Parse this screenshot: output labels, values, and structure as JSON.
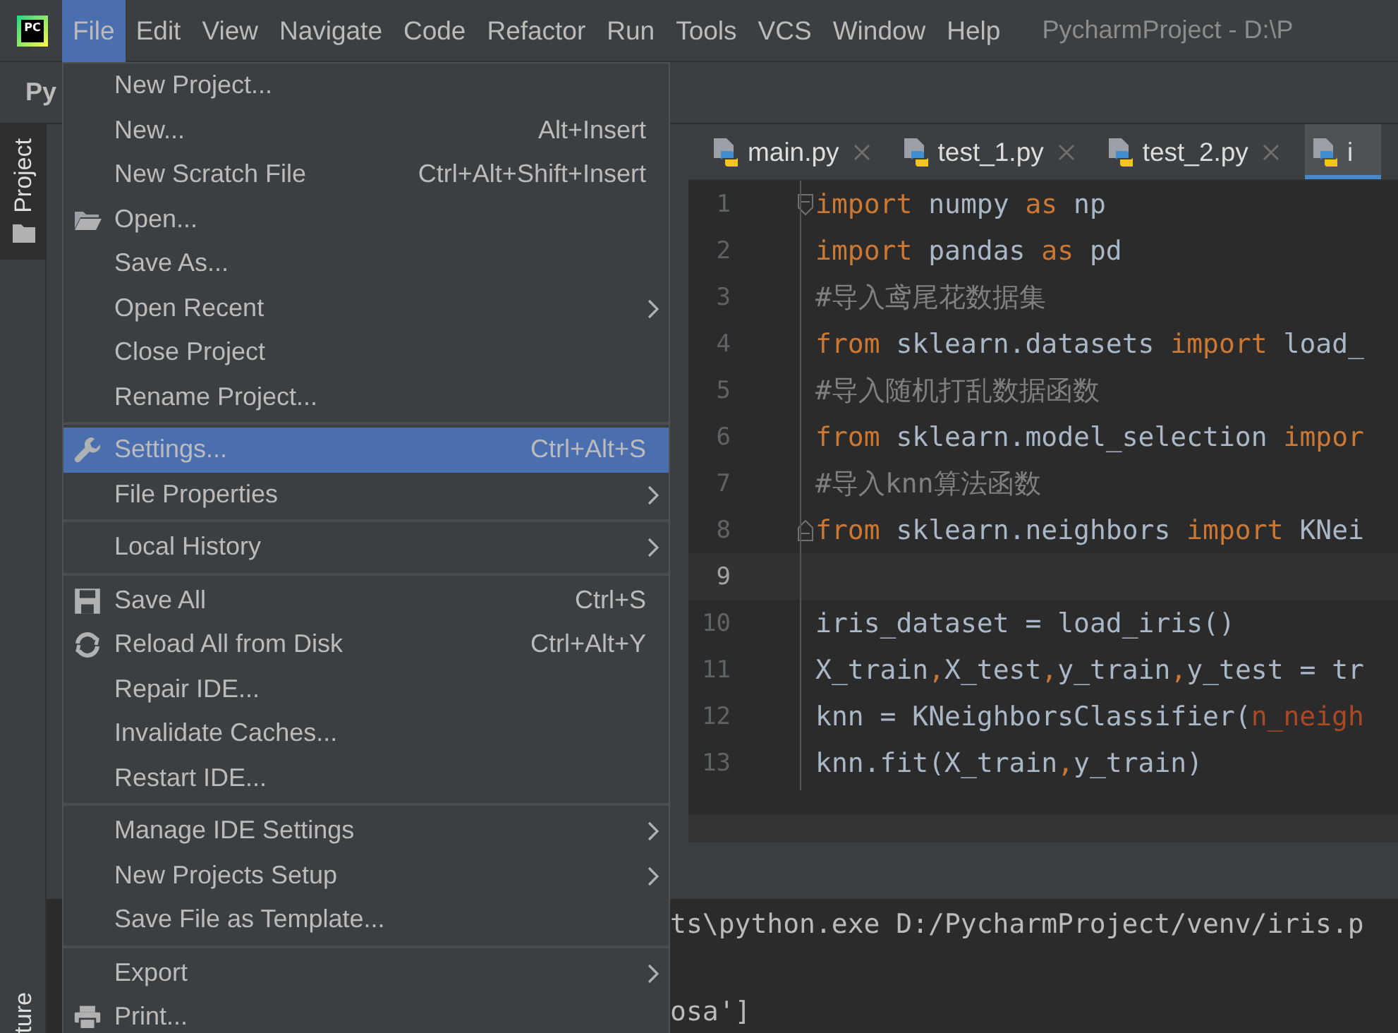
{
  "app_logo": {
    "text": "PC"
  },
  "menubar": [
    {
      "label": "File",
      "selected": true
    },
    {
      "label": "Edit",
      "selected": false
    },
    {
      "label": "View",
      "selected": false
    },
    {
      "label": "Navigate",
      "selected": false
    },
    {
      "label": "Code",
      "selected": false
    },
    {
      "label": "Refactor",
      "selected": false
    },
    {
      "label": "Run",
      "selected": false
    },
    {
      "label": "Tools",
      "selected": false
    },
    {
      "label": "VCS",
      "selected": false
    },
    {
      "label": "Window",
      "selected": false
    },
    {
      "label": "Help",
      "selected": false
    }
  ],
  "window": {
    "title": "PycharmProject - D:\\P"
  },
  "toolbar": {
    "project_name": "Py"
  },
  "tool_tabs": [
    {
      "label": "Project",
      "selected": true
    },
    {
      "label": "ture",
      "selected": false
    }
  ],
  "editor_tabs": [
    {
      "label": "main.py",
      "selected": false,
      "closable": true
    },
    {
      "label": "test_1.py",
      "selected": false,
      "closable": true
    },
    {
      "label": "test_2.py",
      "selected": false,
      "closable": true
    },
    {
      "label": "i",
      "selected": true,
      "closable": false
    }
  ],
  "code_lines": [
    {
      "number": "1",
      "current": false,
      "tokens": [
        {
          "text": "import",
          "kind": "keyword"
        },
        {
          "text": " numpy ",
          "kind": "plain"
        },
        {
          "text": "as",
          "kind": "keyword"
        },
        {
          "text": " np",
          "kind": "plain"
        }
      ]
    },
    {
      "number": "2",
      "current": false,
      "tokens": [
        {
          "text": "import",
          "kind": "keyword"
        },
        {
          "text": " pandas ",
          "kind": "plain"
        },
        {
          "text": "as",
          "kind": "keyword"
        },
        {
          "text": " pd",
          "kind": "plain"
        }
      ]
    },
    {
      "number": "3",
      "current": false,
      "tokens": [
        {
          "text": "#导入鸢尾花数据集",
          "kind": "comment"
        }
      ]
    },
    {
      "number": "4",
      "current": false,
      "tokens": [
        {
          "text": "from",
          "kind": "keyword"
        },
        {
          "text": " sklearn.datasets ",
          "kind": "plain"
        },
        {
          "text": "import",
          "kind": "keyword"
        },
        {
          "text": " load_",
          "kind": "plain"
        }
      ]
    },
    {
      "number": "5",
      "current": false,
      "tokens": [
        {
          "text": "#导入随机打乱数据函数",
          "kind": "comment"
        }
      ]
    },
    {
      "number": "6",
      "current": false,
      "tokens": [
        {
          "text": "from",
          "kind": "keyword"
        },
        {
          "text": " sklearn.model_selection ",
          "kind": "plain"
        },
        {
          "text": "impor",
          "kind": "keyword"
        }
      ]
    },
    {
      "number": "7",
      "current": false,
      "tokens": [
        {
          "text": "#导入knn算法函数",
          "kind": "comment"
        }
      ]
    },
    {
      "number": "8",
      "current": false,
      "tokens": [
        {
          "text": "from",
          "kind": "keyword"
        },
        {
          "text": " sklearn.neighbors ",
          "kind": "plain"
        },
        {
          "text": "import",
          "kind": "keyword"
        },
        {
          "text": " KNei",
          "kind": "plain"
        }
      ]
    },
    {
      "number": "9",
      "current": true
    },
    {
      "number": "10",
      "current": false,
      "tokens": [
        {
          "text": "iris_dataset = load_iris()",
          "kind": "plain"
        }
      ]
    },
    {
      "number": "11",
      "current": false,
      "tokens": [
        {
          "text": "X_train",
          "kind": "plain"
        },
        {
          "text": ",",
          "kind": "comma"
        },
        {
          "text": "X_test",
          "kind": "plain"
        },
        {
          "text": ",",
          "kind": "comma"
        },
        {
          "text": "y_train",
          "kind": "plain"
        },
        {
          "text": ",",
          "kind": "comma"
        },
        {
          "text": "y_test = tr",
          "kind": "plain"
        }
      ]
    },
    {
      "number": "12",
      "current": false,
      "tokens": [
        {
          "text": "knn = KNeighborsClassifier(",
          "kind": "plain"
        },
        {
          "text": "n_neigh",
          "kind": "param"
        }
      ]
    },
    {
      "number": "13",
      "current": false,
      "tokens": [
        {
          "text": "knn.fit(X_train",
          "kind": "plain"
        },
        {
          "text": ",",
          "kind": "comma"
        },
        {
          "text": "y_train)",
          "kind": "plain"
        }
      ]
    }
  ],
  "console_lines": [
    "ts\\python.exe D:/PycharmProject/venv/iris.p",
    "osa']"
  ],
  "file_menu": {
    "groups": [
      [
        {
          "label": "New Project...",
          "selected": false
        },
        {
          "label": "New...",
          "shortcut": "Alt+Insert",
          "selected": false
        },
        {
          "label": "New Scratch File",
          "shortcut": "Ctrl+Alt+Shift+Insert",
          "selected": false
        },
        {
          "label": "Open...",
          "selected": false
        },
        {
          "label": "Save As...",
          "selected": false
        },
        {
          "label": "Open Recent",
          "submenu": true,
          "selected": false
        },
        {
          "label": "Close Project",
          "selected": false
        },
        {
          "label": "Rename Project...",
          "selected": false
        }
      ],
      [
        {
          "label": "Settings...",
          "shortcut": "Ctrl+Alt+S",
          "selected": true
        },
        {
          "label": "File Properties",
          "submenu": true,
          "selected": false
        }
      ],
      [
        {
          "label": "Local History",
          "submenu": true,
          "selected": false
        }
      ],
      [
        {
          "label": "Save All",
          "shortcut": "Ctrl+S",
          "selected": false
        },
        {
          "label": "Reload All from Disk",
          "shortcut": "Ctrl+Alt+Y",
          "selected": false
        },
        {
          "label": "Repair IDE...",
          "selected": false
        },
        {
          "label": "Invalidate Caches...",
          "selected": false
        },
        {
          "label": "Restart IDE...",
          "selected": false
        }
      ],
      [
        {
          "label": "Manage IDE Settings",
          "submenu": true,
          "selected": false
        },
        {
          "label": "New Projects Setup",
          "submenu": true,
          "selected": false
        },
        {
          "label": "Save File as Template...",
          "selected": false
        }
      ],
      [
        {
          "label": "Export",
          "submenu": true,
          "selected": false
        },
        {
          "label": "Print...",
          "selected": false
        }
      ]
    ]
  }
}
